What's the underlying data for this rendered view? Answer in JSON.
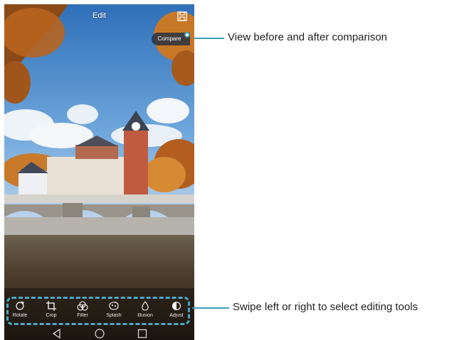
{
  "screen": {
    "title": "Edit",
    "compare_label": "Compare"
  },
  "toolbar": {
    "tools": [
      {
        "label": "Rotate",
        "icon": "rotate-icon"
      },
      {
        "label": "Crop",
        "icon": "crop-icon"
      },
      {
        "label": "Filter",
        "icon": "filter-icon"
      },
      {
        "label": "Splash",
        "icon": "splash-icon"
      },
      {
        "label": "Illusion",
        "icon": "illusion-icon"
      },
      {
        "label": "Adjust",
        "icon": "adjust-icon"
      }
    ]
  },
  "nav": {
    "icons": [
      "back-icon",
      "home-icon",
      "recents-icon"
    ]
  },
  "callouts": {
    "compare": "View before and after comparison",
    "tools": "Swipe left or right to select editing tools"
  },
  "colors": {
    "accent": "#3a9fb6",
    "highlight": "#4aa9c4",
    "sky": "#3b7fc4",
    "water": "#4a3a2a"
  }
}
